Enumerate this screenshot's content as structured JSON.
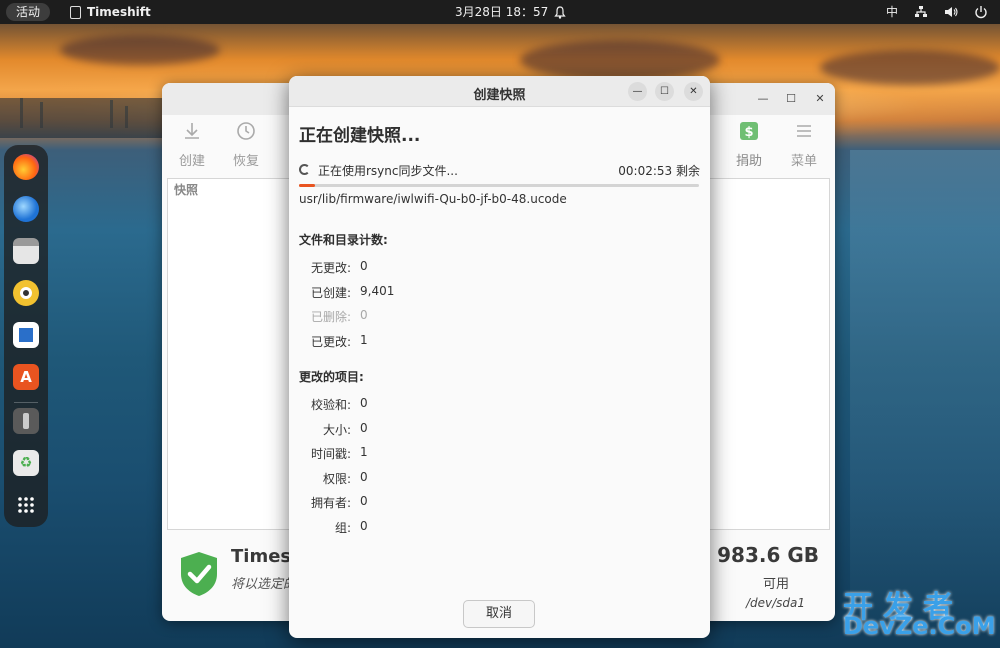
{
  "topbar": {
    "activities": "活动",
    "app_name": "Timeshift",
    "clock": "3月28日  18：57",
    "input_method": "中"
  },
  "main_window": {
    "toolbar": {
      "create": "创建",
      "restore": "恢复",
      "donate": "捐助",
      "menu": "菜单"
    },
    "list_header": "快照",
    "status_title": "Timesh",
    "status_subtitle": "将以选定的",
    "disk_free": "983.6 GB",
    "disk_free_label": "可用",
    "disk_device": "/dev/sda1"
  },
  "dialog": {
    "title": "创建快照",
    "heading": "正在创建快照...",
    "sync_status": "正在使用rsync同步文件...",
    "time_remaining": "00:02:53 剩余",
    "progress_fraction": 0.04,
    "current_file": "usr/lib/firmware/iwlwifi-Qu-b0-jf-b0-48.ucode",
    "counts_title": "文件和目录计数:",
    "counts": [
      {
        "label": "无更改:",
        "value": "0",
        "dim": false
      },
      {
        "label": "已创建:",
        "value": "9,401",
        "dim": false
      },
      {
        "label": "已删除:",
        "value": "0",
        "dim": true
      },
      {
        "label": "已更改:",
        "value": "1",
        "dim": false
      }
    ],
    "changed_title": "更改的项目:",
    "changed": [
      {
        "label": "校验和:",
        "value": "0"
      },
      {
        "label": "大小:",
        "value": "0"
      },
      {
        "label": "时间戳:",
        "value": "1"
      },
      {
        "label": "权限:",
        "value": "0"
      },
      {
        "label": "拥有者:",
        "value": "0"
      },
      {
        "label": "组:",
        "value": "0"
      }
    ],
    "cancel": "取消"
  },
  "watermark": {
    "top": "开发者",
    "bottom": "DevZe.CoM"
  },
  "colors": {
    "accent": "#e95420",
    "shield": "#4caf50",
    "watermark": "#3aa0e8"
  }
}
